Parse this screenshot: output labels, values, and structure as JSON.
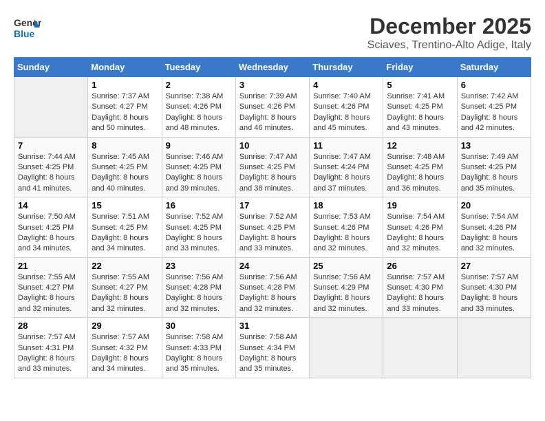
{
  "logo": {
    "line1": "General",
    "line2": "Blue"
  },
  "title": "December 2025",
  "subtitle": "Sciaves, Trentino-Alto Adige, Italy",
  "weekdays": [
    "Sunday",
    "Monday",
    "Tuesday",
    "Wednesday",
    "Thursday",
    "Friday",
    "Saturday"
  ],
  "weeks": [
    [
      {
        "day": null,
        "info": null
      },
      {
        "day": "1",
        "sunrise": "7:37 AM",
        "sunset": "4:27 PM",
        "daylight": "8 hours and 50 minutes."
      },
      {
        "day": "2",
        "sunrise": "7:38 AM",
        "sunset": "4:26 PM",
        "daylight": "8 hours and 48 minutes."
      },
      {
        "day": "3",
        "sunrise": "7:39 AM",
        "sunset": "4:26 PM",
        "daylight": "8 hours and 46 minutes."
      },
      {
        "day": "4",
        "sunrise": "7:40 AM",
        "sunset": "4:26 PM",
        "daylight": "8 hours and 45 minutes."
      },
      {
        "day": "5",
        "sunrise": "7:41 AM",
        "sunset": "4:25 PM",
        "daylight": "8 hours and 43 minutes."
      },
      {
        "day": "6",
        "sunrise": "7:42 AM",
        "sunset": "4:25 PM",
        "daylight": "8 hours and 42 minutes."
      }
    ],
    [
      {
        "day": "7",
        "sunrise": "7:44 AM",
        "sunset": "4:25 PM",
        "daylight": "8 hours and 41 minutes."
      },
      {
        "day": "8",
        "sunrise": "7:45 AM",
        "sunset": "4:25 PM",
        "daylight": "8 hours and 40 minutes."
      },
      {
        "day": "9",
        "sunrise": "7:46 AM",
        "sunset": "4:25 PM",
        "daylight": "8 hours and 39 minutes."
      },
      {
        "day": "10",
        "sunrise": "7:47 AM",
        "sunset": "4:25 PM",
        "daylight": "8 hours and 38 minutes."
      },
      {
        "day": "11",
        "sunrise": "7:47 AM",
        "sunset": "4:24 PM",
        "daylight": "8 hours and 37 minutes."
      },
      {
        "day": "12",
        "sunrise": "7:48 AM",
        "sunset": "4:25 PM",
        "daylight": "8 hours and 36 minutes."
      },
      {
        "day": "13",
        "sunrise": "7:49 AM",
        "sunset": "4:25 PM",
        "daylight": "8 hours and 35 minutes."
      }
    ],
    [
      {
        "day": "14",
        "sunrise": "7:50 AM",
        "sunset": "4:25 PM",
        "daylight": "8 hours and 34 minutes."
      },
      {
        "day": "15",
        "sunrise": "7:51 AM",
        "sunset": "4:25 PM",
        "daylight": "8 hours and 34 minutes."
      },
      {
        "day": "16",
        "sunrise": "7:52 AM",
        "sunset": "4:25 PM",
        "daylight": "8 hours and 33 minutes."
      },
      {
        "day": "17",
        "sunrise": "7:52 AM",
        "sunset": "4:25 PM",
        "daylight": "8 hours and 33 minutes."
      },
      {
        "day": "18",
        "sunrise": "7:53 AM",
        "sunset": "4:26 PM",
        "daylight": "8 hours and 32 minutes."
      },
      {
        "day": "19",
        "sunrise": "7:54 AM",
        "sunset": "4:26 PM",
        "daylight": "8 hours and 32 minutes."
      },
      {
        "day": "20",
        "sunrise": "7:54 AM",
        "sunset": "4:26 PM",
        "daylight": "8 hours and 32 minutes."
      }
    ],
    [
      {
        "day": "21",
        "sunrise": "7:55 AM",
        "sunset": "4:27 PM",
        "daylight": "8 hours and 32 minutes."
      },
      {
        "day": "22",
        "sunrise": "7:55 AM",
        "sunset": "4:27 PM",
        "daylight": "8 hours and 32 minutes."
      },
      {
        "day": "23",
        "sunrise": "7:56 AM",
        "sunset": "4:28 PM",
        "daylight": "8 hours and 32 minutes."
      },
      {
        "day": "24",
        "sunrise": "7:56 AM",
        "sunset": "4:28 PM",
        "daylight": "8 hours and 32 minutes."
      },
      {
        "day": "25",
        "sunrise": "7:56 AM",
        "sunset": "4:29 PM",
        "daylight": "8 hours and 32 minutes."
      },
      {
        "day": "26",
        "sunrise": "7:57 AM",
        "sunset": "4:30 PM",
        "daylight": "8 hours and 33 minutes."
      },
      {
        "day": "27",
        "sunrise": "7:57 AM",
        "sunset": "4:30 PM",
        "daylight": "8 hours and 33 minutes."
      }
    ],
    [
      {
        "day": "28",
        "sunrise": "7:57 AM",
        "sunset": "4:31 PM",
        "daylight": "8 hours and 33 minutes."
      },
      {
        "day": "29",
        "sunrise": "7:57 AM",
        "sunset": "4:32 PM",
        "daylight": "8 hours and 34 minutes."
      },
      {
        "day": "30",
        "sunrise": "7:58 AM",
        "sunset": "4:33 PM",
        "daylight": "8 hours and 35 minutes."
      },
      {
        "day": "31",
        "sunrise": "7:58 AM",
        "sunset": "4:34 PM",
        "daylight": "8 hours and 35 minutes."
      },
      {
        "day": null,
        "info": null
      },
      {
        "day": null,
        "info": null
      },
      {
        "day": null,
        "info": null
      }
    ]
  ]
}
